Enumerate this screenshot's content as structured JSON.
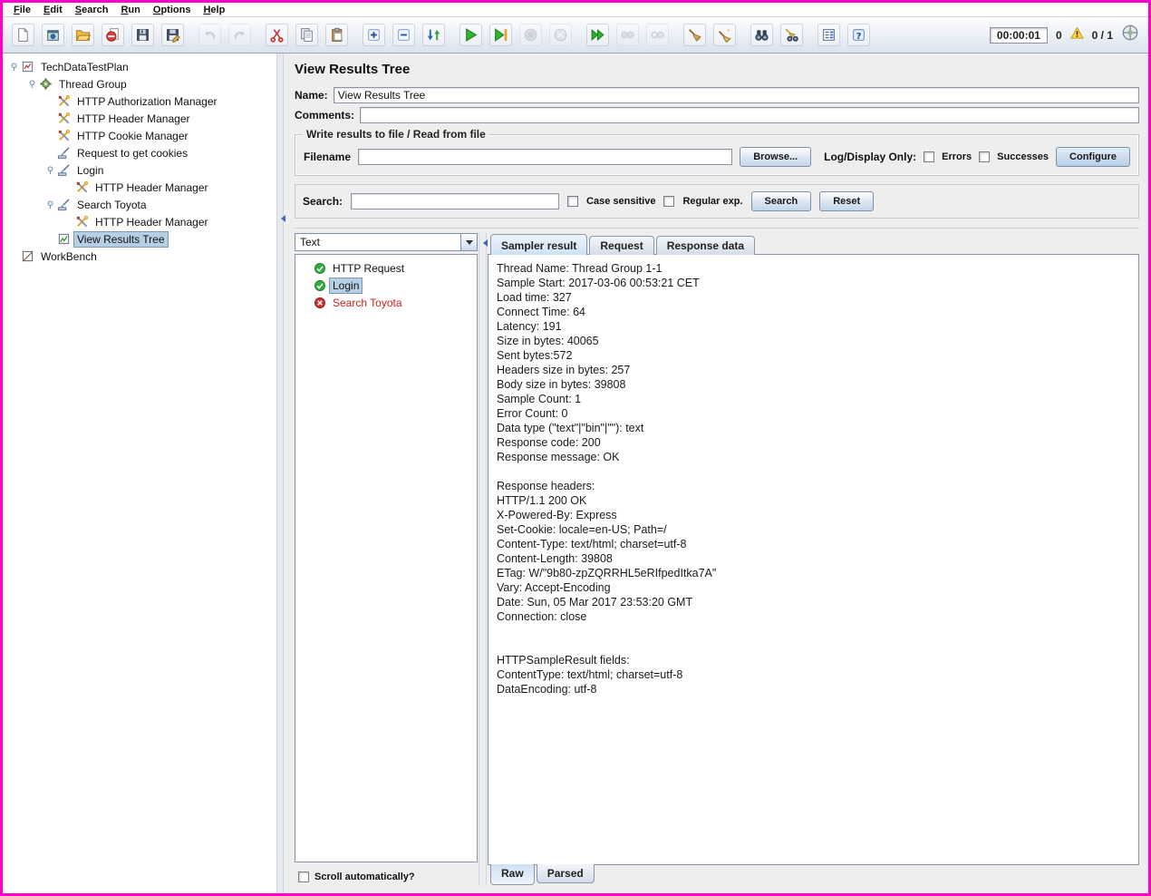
{
  "window": {
    "border_color": "#ff00cc"
  },
  "colors": {
    "selection": "#b6cfe4",
    "error_text": "#cc2222",
    "success_green": "#2fae3e",
    "error_red": "#cc2d2d",
    "warning_yellow": "#ffd43a"
  },
  "menu": {
    "items": [
      {
        "label": "File"
      },
      {
        "label": "Edit"
      },
      {
        "label": "Search"
      },
      {
        "label": "Run"
      },
      {
        "label": "Options"
      },
      {
        "label": "Help"
      }
    ]
  },
  "toolbar": {
    "groups": [
      [
        {
          "name": "new-file"
        },
        {
          "name": "templates"
        },
        {
          "name": "open-folder"
        },
        {
          "name": "close-file"
        },
        {
          "name": "save"
        },
        {
          "name": "save-as"
        }
      ],
      [
        {
          "name": "undo",
          "enabled": false
        },
        {
          "name": "redo",
          "enabled": false
        }
      ],
      [
        {
          "name": "cut"
        },
        {
          "name": "copy"
        },
        {
          "name": "paste"
        }
      ],
      [
        {
          "name": "expand-all"
        },
        {
          "name": "collapse-all"
        },
        {
          "name": "toggle"
        }
      ],
      [
        {
          "name": "start"
        },
        {
          "name": "start-no-pauses"
        },
        {
          "name": "stop",
          "enabled": false
        },
        {
          "name": "shutdown",
          "enabled": false
        }
      ],
      [
        {
          "name": "remote-start-all"
        },
        {
          "name": "remote-stop-all",
          "enabled": false
        },
        {
          "name": "remote-shutdown-all",
          "enabled": false
        }
      ],
      [
        {
          "name": "clear"
        },
        {
          "name": "clear-all"
        }
      ],
      [
        {
          "name": "search"
        },
        {
          "name": "search-reset"
        }
      ],
      [
        {
          "name": "function-helper"
        },
        {
          "name": "help"
        }
      ]
    ],
    "timer": "00:00:01",
    "log_count": "0",
    "thread_count": "0 / 1"
  },
  "test_tree": {
    "items": [
      {
        "label": "TechDataTestPlan",
        "depth": 0,
        "icon": "test-plan",
        "knob": true
      },
      {
        "label": "Thread Group",
        "depth": 1,
        "icon": "thread-group",
        "knob": true
      },
      {
        "label": "HTTP Authorization Manager",
        "depth": 2,
        "icon": "config",
        "knob": false
      },
      {
        "label": "HTTP Header Manager",
        "depth": 2,
        "icon": "config",
        "knob": false
      },
      {
        "label": "HTTP Cookie Manager",
        "depth": 2,
        "icon": "config",
        "knob": false
      },
      {
        "label": "Request to get cookies",
        "depth": 2,
        "icon": "sampler",
        "knob": false
      },
      {
        "label": "Login",
        "depth": 2,
        "icon": "sampler",
        "knob": true
      },
      {
        "label": "HTTP Header Manager",
        "depth": 3,
        "icon": "config",
        "knob": false
      },
      {
        "label": "Search Toyota",
        "depth": 2,
        "icon": "sampler",
        "knob": true
      },
      {
        "label": "HTTP Header Manager",
        "depth": 3,
        "icon": "config",
        "knob": false
      },
      {
        "label": "View Results Tree",
        "depth": 2,
        "icon": "listener",
        "knob": false,
        "selected": true
      },
      {
        "label": "WorkBench",
        "depth": 0,
        "icon": "workbench",
        "knob": false
      }
    ]
  },
  "main": {
    "title": "View Results Tree",
    "name": {
      "label": "Name:",
      "value": "View Results Tree"
    },
    "comments": {
      "label": "Comments:",
      "value": ""
    },
    "file_panel": {
      "title": "Write results to file / Read from file",
      "filename_label": "Filename",
      "filename_value": "",
      "browse_button": "Browse...",
      "log_display_label": "Log/Display Only:",
      "errors_checkbox": "Errors",
      "successes_checkbox": "Successes",
      "configure_button": "Configure"
    },
    "search_panel": {
      "label": "Search:",
      "value": "",
      "case_checkbox": "Case sensitive",
      "regex_checkbox": "Regular exp.",
      "search_button": "Search",
      "reset_button": "Reset"
    },
    "results": {
      "renderer": "Text",
      "items": [
        {
          "label": "HTTP Request",
          "status": "success"
        },
        {
          "label": "Login",
          "status": "success",
          "selected": true
        },
        {
          "label": "Search Toyota",
          "status": "error"
        }
      ],
      "scroll_checkbox": "Scroll automatically?"
    },
    "tabs": [
      {
        "label": "Sampler result",
        "selected": true
      },
      {
        "label": "Request"
      },
      {
        "label": "Response data"
      }
    ],
    "bottom_tabs": [
      {
        "label": "Raw",
        "selected": true
      },
      {
        "label": "Parsed"
      }
    ],
    "sampler_result_lines": [
      "Thread Name: Thread Group 1-1",
      "Sample Start: 2017-03-06 00:53:21 CET",
      "Load time: 327",
      "Connect Time: 64",
      "Latency: 191",
      "Size in bytes: 40065",
      "Sent bytes:572",
      "Headers size in bytes: 257",
      "Body size in bytes: 39808",
      "Sample Count: 1",
      "Error Count: 0",
      "Data type (\"text\"|\"bin\"|\"\"): text",
      "Response code: 200",
      "Response message: OK",
      "",
      "Response headers:",
      "HTTP/1.1 200 OK",
      "X-Powered-By: Express",
      "Set-Cookie: locale=en-US; Path=/",
      "Content-Type: text/html; charset=utf-8",
      "Content-Length: 39808",
      "ETag: W/\"9b80-zpZQRRHL5eRIfpedItka7A\"",
      "Vary: Accept-Encoding",
      "Date: Sun, 05 Mar 2017 23:53:20 GMT",
      "Connection: close",
      "",
      "",
      "HTTPSampleResult fields:",
      "ContentType: text/html; charset=utf-8",
      "DataEncoding: utf-8"
    ]
  }
}
